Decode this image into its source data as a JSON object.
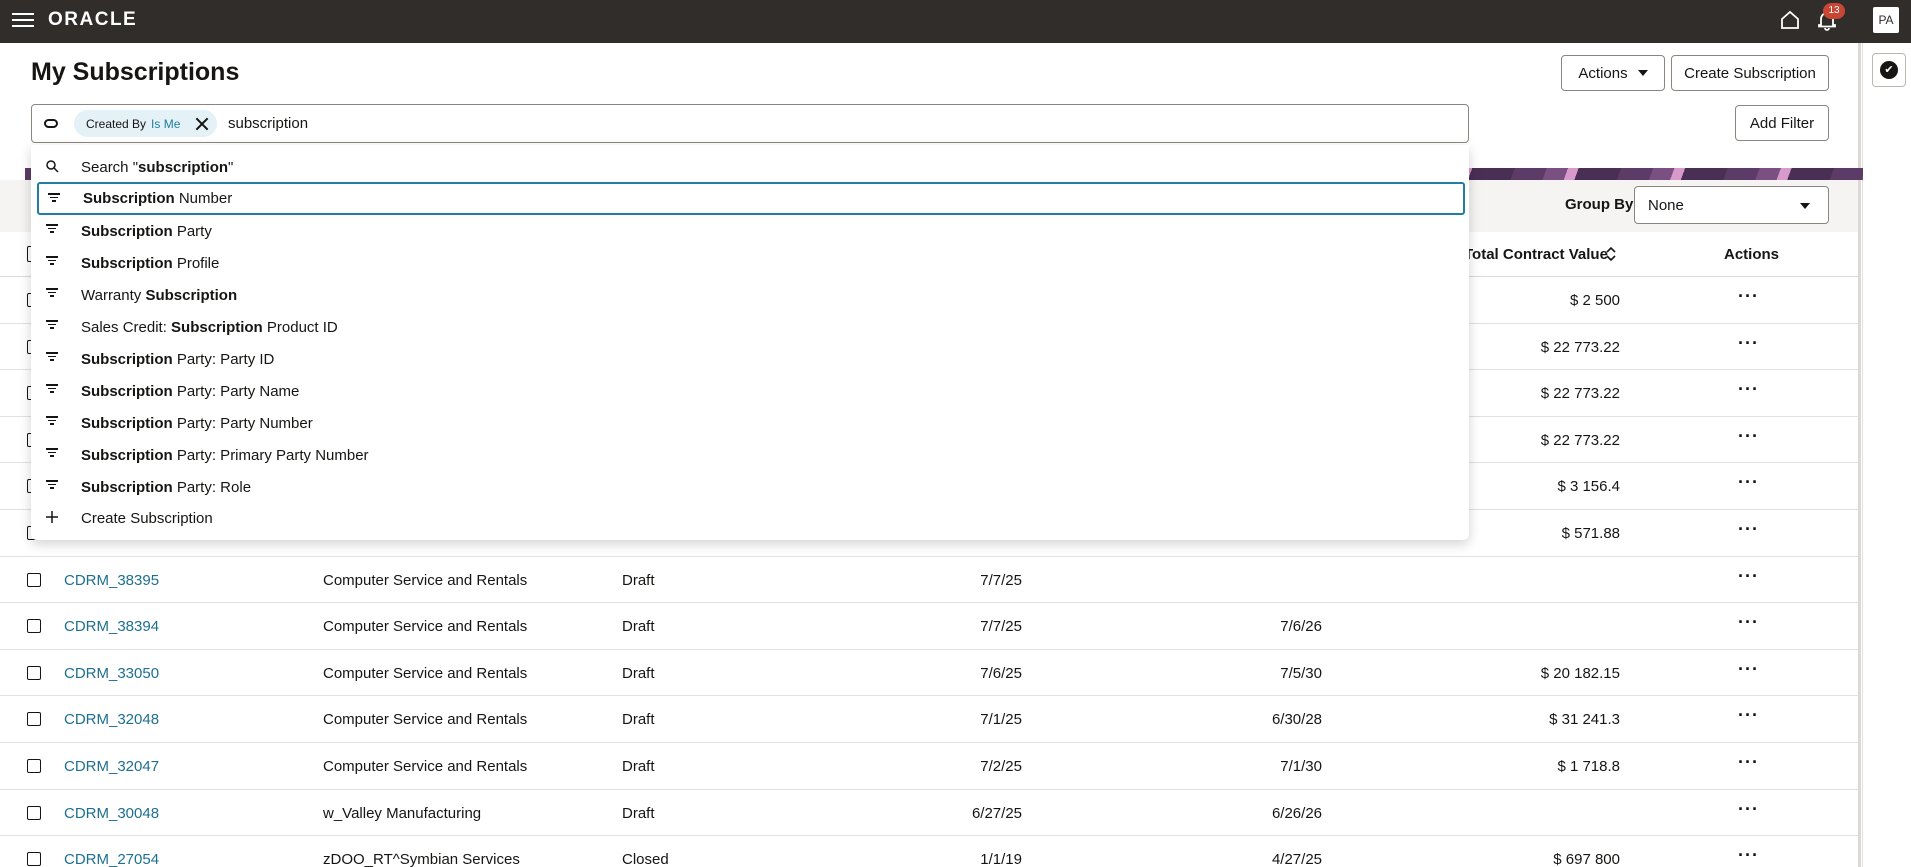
{
  "topbar": {
    "brand": "ORACLE",
    "notification_count": "13",
    "avatar_initials": "PA"
  },
  "header": {
    "title": "My Subscriptions",
    "actions_label": "Actions",
    "create_label": "Create Subscription",
    "add_filter_label": "Add Filter"
  },
  "search": {
    "chip_key": "Created By",
    "chip_value": "Is Me",
    "query": "subscription"
  },
  "dropdown": {
    "search_prefix": "Search \"",
    "search_term": "subscription",
    "search_suffix": "\"",
    "options": [
      {
        "pre": "",
        "bold": "Subscription",
        "post": " Number"
      },
      {
        "pre": "",
        "bold": "Subscription",
        "post": " Party"
      },
      {
        "pre": "",
        "bold": "Subscription",
        "post": " Profile"
      },
      {
        "pre": "Warranty ",
        "bold": "Subscription",
        "post": ""
      },
      {
        "pre": "Sales Credit: ",
        "bold": "Subscription",
        "post": " Product ID"
      },
      {
        "pre": "",
        "bold": "Subscription",
        "post": " Party: Party ID"
      },
      {
        "pre": "",
        "bold": "Subscription",
        "post": " Party: Party Name"
      },
      {
        "pre": "",
        "bold": "Subscription",
        "post": " Party: Party Number"
      },
      {
        "pre": "",
        "bold": "Subscription",
        "post": " Party: Primary Party Number"
      },
      {
        "pre": "",
        "bold": "Subscription",
        "post": " Party: Role"
      }
    ],
    "create_label": "Create Subscription"
  },
  "group_by": {
    "label": "Group By",
    "value": "None"
  },
  "table": {
    "headers": {
      "total_contract_value": "Total Contract Value",
      "actions": "Actions"
    },
    "hidden_rows_tcv": [
      "$ 2 500",
      "$ 22 773.22",
      "$ 22 773.22",
      "$ 22 773.22",
      "$ 3 156.4",
      "$ 571.88"
    ],
    "rows": [
      {
        "number": "CDRM_38395",
        "party": "Computer Service and Rentals",
        "status": "Draft",
        "start": "7/7/25",
        "end": "",
        "tcv": ""
      },
      {
        "number": "CDRM_38394",
        "party": "Computer Service and Rentals",
        "status": "Draft",
        "start": "7/7/25",
        "end": "7/6/26",
        "tcv": ""
      },
      {
        "number": "CDRM_33050",
        "party": "Computer Service and Rentals",
        "status": "Draft",
        "start": "7/6/25",
        "end": "7/5/30",
        "tcv": "$ 20 182.15"
      },
      {
        "number": "CDRM_32048",
        "party": "Computer Service and Rentals",
        "status": "Draft",
        "start": "7/1/25",
        "end": "6/30/28",
        "tcv": "$ 31 241.3"
      },
      {
        "number": "CDRM_32047",
        "party": "Computer Service and Rentals",
        "status": "Draft",
        "start": "7/2/25",
        "end": "7/1/30",
        "tcv": "$ 1 718.8"
      },
      {
        "number": "CDRM_30048",
        "party": "w_Valley Manufacturing",
        "status": "Draft",
        "start": "6/27/25",
        "end": "6/26/26",
        "tcv": ""
      },
      {
        "number": "CDRM_27054",
        "party": "zDOO_RT^Symbian Services",
        "status": "Closed",
        "start": "1/1/19",
        "end": "4/27/25",
        "tcv": "$ 697 800"
      }
    ]
  }
}
